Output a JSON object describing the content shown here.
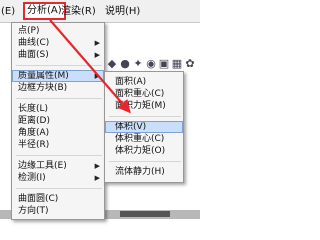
{
  "menubar": {
    "items": [
      {
        "label": "(E)"
      },
      {
        "label": "分析(A)"
      },
      {
        "label": "渲染(R)"
      },
      {
        "label": "说明(H)"
      }
    ]
  },
  "analysis_menu": {
    "items": [
      {
        "label": "点(P)",
        "submenu": false
      },
      {
        "label": "曲线(C)",
        "submenu": true
      },
      {
        "label": "曲面(S)",
        "submenu": true
      },
      {
        "label": "质量属性(M)",
        "submenu": true,
        "highlighted": true
      },
      {
        "label": "边框方块(B)",
        "submenu": false
      },
      {
        "label": "长度(L)",
        "submenu": false
      },
      {
        "label": "距离(D)",
        "submenu": false
      },
      {
        "label": "角度(A)",
        "submenu": false
      },
      {
        "label": "半径(R)",
        "submenu": false
      },
      {
        "label": "边缘工具(E)",
        "submenu": true
      },
      {
        "label": "检测(I)",
        "submenu": true
      },
      {
        "label": "曲面圆(C)",
        "submenu": false
      },
      {
        "label": "方向(T)",
        "submenu": false
      }
    ]
  },
  "mass_submenu": {
    "items": [
      {
        "label": "面积(A)"
      },
      {
        "label": "面积重心(C)"
      },
      {
        "label": "面积力矩(M)"
      },
      {
        "label": "体积(V)",
        "highlighted": true
      },
      {
        "label": "体积重心(C)"
      },
      {
        "label": "体积力矩(O)"
      },
      {
        "label": "流体静力(H)"
      }
    ]
  },
  "colors": {
    "highlight_box": "#e6272e",
    "menu_highlight": "#c9defa"
  },
  "toolbar_icons": [
    "shape-icon",
    "sphere-icon",
    "gear-icon",
    "render-icon",
    "material-icon",
    "grid-icon",
    "settings-icon"
  ]
}
